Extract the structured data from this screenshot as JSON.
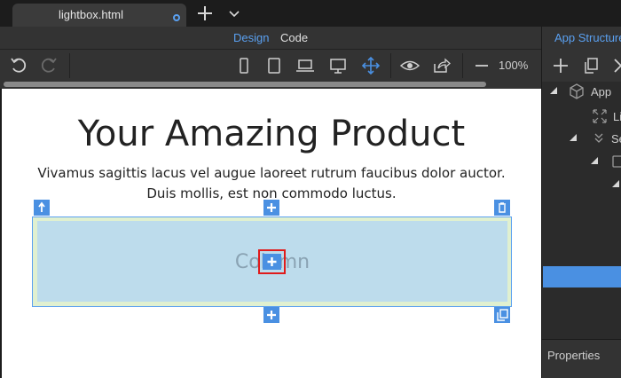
{
  "tab": {
    "title": "lightbox.html"
  },
  "modes": {
    "design": "Design",
    "code": "Code"
  },
  "toolbar": {
    "zoom": "100%"
  },
  "canvas": {
    "heading": "Your Amazing Product",
    "lead": "Vivamus sagittis lacus vel augue laoreet rutrum faucibus dolor auctor. Duis mollis, est non commodo luctus.",
    "column_label": "Column"
  },
  "right_panel": {
    "title": "App Structure",
    "tree": [
      {
        "label": "App",
        "icon": "cube-icon"
      },
      {
        "label": "Li",
        "icon": "lightbox-icon"
      },
      {
        "label": "Se",
        "icon": "section-icon"
      }
    ],
    "properties_label": "Properties"
  },
  "colors": {
    "accent": "#4a90e2",
    "highlight": "#e01b1b",
    "column_fill": "#bddcec",
    "row_fill": "#e0f0d0"
  }
}
